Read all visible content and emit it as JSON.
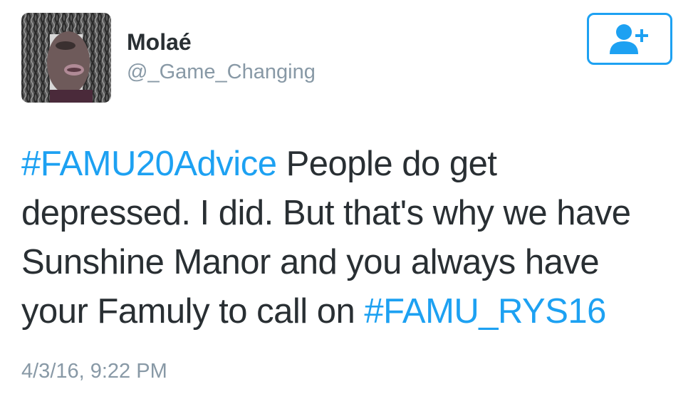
{
  "user": {
    "display_name": "Molaé",
    "handle": "@_Game_Changing"
  },
  "follow_button": {
    "icon": "add-user-icon"
  },
  "tweet": {
    "lines": [
      {
        "hashtag": "#FAMU20Advice",
        "text": " People do get"
      },
      {
        "text": "depressed. I did. But that's why we have"
      },
      {
        "text": "Sunshine Manor and you always have"
      },
      {
        "text": "your Famuly to call on ",
        "hashtag": "#FAMU_RYS16"
      }
    ],
    "timestamp": "4/3/16, 9:22 PM"
  },
  "colors": {
    "accent": "#1da1f2",
    "text": "#292f33",
    "muted": "#8899a6"
  }
}
